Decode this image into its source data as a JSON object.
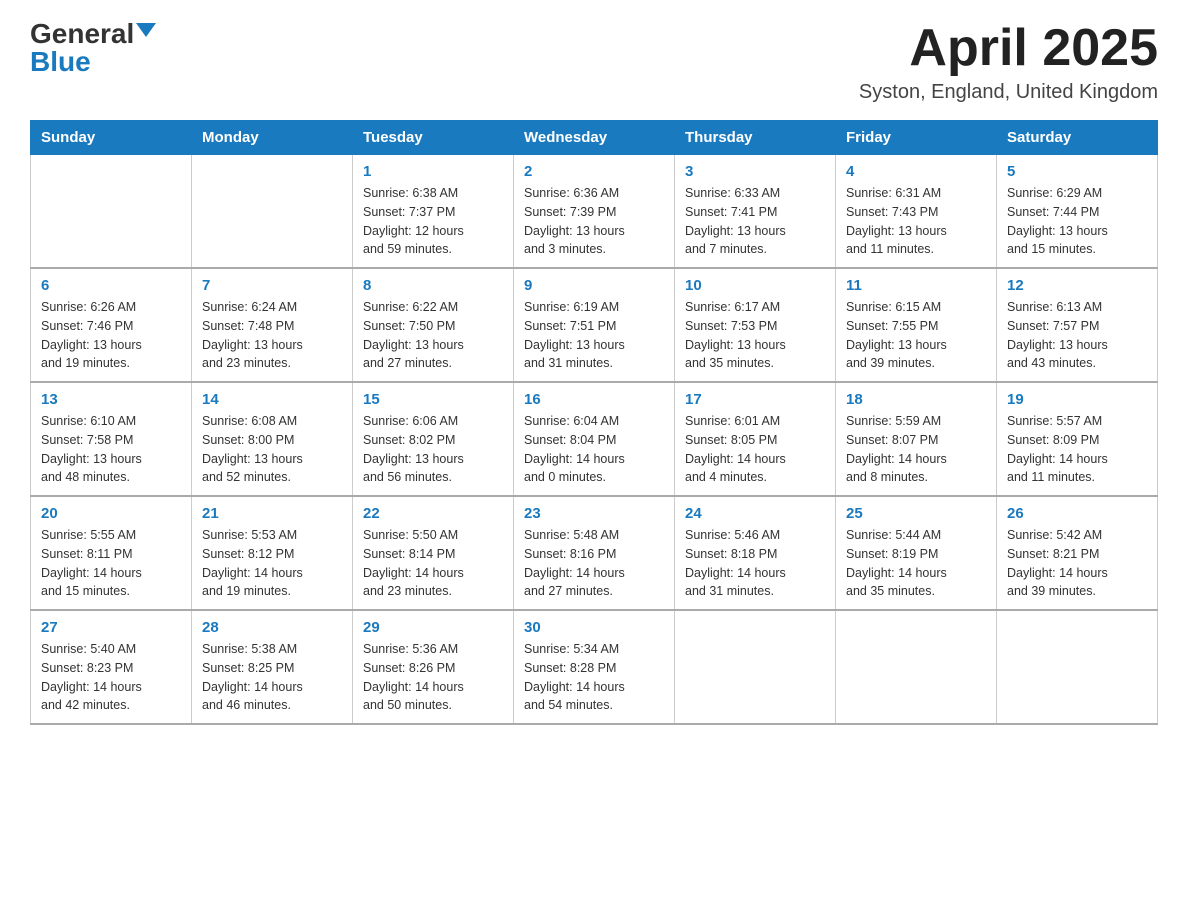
{
  "header": {
    "logo_general": "General",
    "logo_blue": "Blue",
    "month_title": "April 2025",
    "location": "Syston, England, United Kingdom"
  },
  "days_of_week": [
    "Sunday",
    "Monday",
    "Tuesday",
    "Wednesday",
    "Thursday",
    "Friday",
    "Saturday"
  ],
  "weeks": [
    [
      {
        "day": "",
        "info": ""
      },
      {
        "day": "",
        "info": ""
      },
      {
        "day": "1",
        "info": "Sunrise: 6:38 AM\nSunset: 7:37 PM\nDaylight: 12 hours\nand 59 minutes."
      },
      {
        "day": "2",
        "info": "Sunrise: 6:36 AM\nSunset: 7:39 PM\nDaylight: 13 hours\nand 3 minutes."
      },
      {
        "day": "3",
        "info": "Sunrise: 6:33 AM\nSunset: 7:41 PM\nDaylight: 13 hours\nand 7 minutes."
      },
      {
        "day": "4",
        "info": "Sunrise: 6:31 AM\nSunset: 7:43 PM\nDaylight: 13 hours\nand 11 minutes."
      },
      {
        "day": "5",
        "info": "Sunrise: 6:29 AM\nSunset: 7:44 PM\nDaylight: 13 hours\nand 15 minutes."
      }
    ],
    [
      {
        "day": "6",
        "info": "Sunrise: 6:26 AM\nSunset: 7:46 PM\nDaylight: 13 hours\nand 19 minutes."
      },
      {
        "day": "7",
        "info": "Sunrise: 6:24 AM\nSunset: 7:48 PM\nDaylight: 13 hours\nand 23 minutes."
      },
      {
        "day": "8",
        "info": "Sunrise: 6:22 AM\nSunset: 7:50 PM\nDaylight: 13 hours\nand 27 minutes."
      },
      {
        "day": "9",
        "info": "Sunrise: 6:19 AM\nSunset: 7:51 PM\nDaylight: 13 hours\nand 31 minutes."
      },
      {
        "day": "10",
        "info": "Sunrise: 6:17 AM\nSunset: 7:53 PM\nDaylight: 13 hours\nand 35 minutes."
      },
      {
        "day": "11",
        "info": "Sunrise: 6:15 AM\nSunset: 7:55 PM\nDaylight: 13 hours\nand 39 minutes."
      },
      {
        "day": "12",
        "info": "Sunrise: 6:13 AM\nSunset: 7:57 PM\nDaylight: 13 hours\nand 43 minutes."
      }
    ],
    [
      {
        "day": "13",
        "info": "Sunrise: 6:10 AM\nSunset: 7:58 PM\nDaylight: 13 hours\nand 48 minutes."
      },
      {
        "day": "14",
        "info": "Sunrise: 6:08 AM\nSunset: 8:00 PM\nDaylight: 13 hours\nand 52 minutes."
      },
      {
        "day": "15",
        "info": "Sunrise: 6:06 AM\nSunset: 8:02 PM\nDaylight: 13 hours\nand 56 minutes."
      },
      {
        "day": "16",
        "info": "Sunrise: 6:04 AM\nSunset: 8:04 PM\nDaylight: 14 hours\nand 0 minutes."
      },
      {
        "day": "17",
        "info": "Sunrise: 6:01 AM\nSunset: 8:05 PM\nDaylight: 14 hours\nand 4 minutes."
      },
      {
        "day": "18",
        "info": "Sunrise: 5:59 AM\nSunset: 8:07 PM\nDaylight: 14 hours\nand 8 minutes."
      },
      {
        "day": "19",
        "info": "Sunrise: 5:57 AM\nSunset: 8:09 PM\nDaylight: 14 hours\nand 11 minutes."
      }
    ],
    [
      {
        "day": "20",
        "info": "Sunrise: 5:55 AM\nSunset: 8:11 PM\nDaylight: 14 hours\nand 15 minutes."
      },
      {
        "day": "21",
        "info": "Sunrise: 5:53 AM\nSunset: 8:12 PM\nDaylight: 14 hours\nand 19 minutes."
      },
      {
        "day": "22",
        "info": "Sunrise: 5:50 AM\nSunset: 8:14 PM\nDaylight: 14 hours\nand 23 minutes."
      },
      {
        "day": "23",
        "info": "Sunrise: 5:48 AM\nSunset: 8:16 PM\nDaylight: 14 hours\nand 27 minutes."
      },
      {
        "day": "24",
        "info": "Sunrise: 5:46 AM\nSunset: 8:18 PM\nDaylight: 14 hours\nand 31 minutes."
      },
      {
        "day": "25",
        "info": "Sunrise: 5:44 AM\nSunset: 8:19 PM\nDaylight: 14 hours\nand 35 minutes."
      },
      {
        "day": "26",
        "info": "Sunrise: 5:42 AM\nSunset: 8:21 PM\nDaylight: 14 hours\nand 39 minutes."
      }
    ],
    [
      {
        "day": "27",
        "info": "Sunrise: 5:40 AM\nSunset: 8:23 PM\nDaylight: 14 hours\nand 42 minutes."
      },
      {
        "day": "28",
        "info": "Sunrise: 5:38 AM\nSunset: 8:25 PM\nDaylight: 14 hours\nand 46 minutes."
      },
      {
        "day": "29",
        "info": "Sunrise: 5:36 AM\nSunset: 8:26 PM\nDaylight: 14 hours\nand 50 minutes."
      },
      {
        "day": "30",
        "info": "Sunrise: 5:34 AM\nSunset: 8:28 PM\nDaylight: 14 hours\nand 54 minutes."
      },
      {
        "day": "",
        "info": ""
      },
      {
        "day": "",
        "info": ""
      },
      {
        "day": "",
        "info": ""
      }
    ]
  ]
}
